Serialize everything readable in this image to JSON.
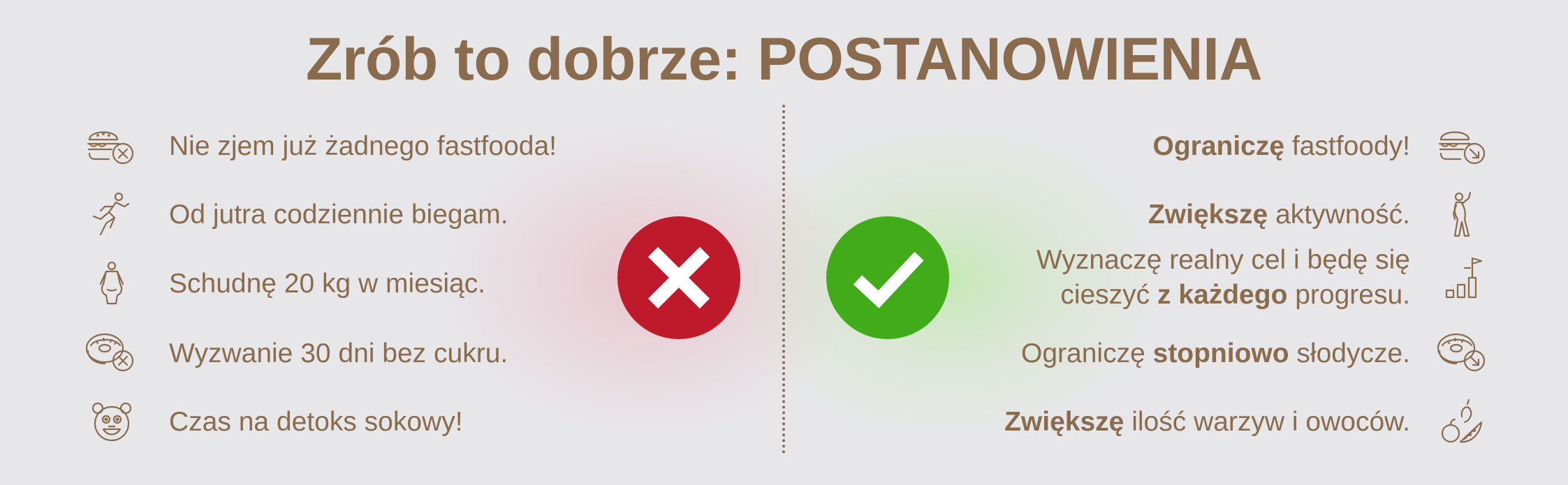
{
  "title": "Zrób to dobrze: POSTANOWIENIA",
  "colors": {
    "brown": "#8b6b4d",
    "red": "#be1a2b",
    "green": "#42ab19",
    "background": "#e7e7e9"
  },
  "bad": [
    {
      "icon": "burger-crossed-icon",
      "text": "Nie zjem już żadnego fastfooda!"
    },
    {
      "icon": "runner-icon",
      "text": "Od jutra codziennie biegam."
    },
    {
      "icon": "person-weight-icon",
      "text": "Schudnę 20 kg w miesiąc."
    },
    {
      "icon": "donut-crossed-icon",
      "text": "Wyzwanie 30 dni bez cukru."
    },
    {
      "icon": "juice-face-icon",
      "text": "Czas na detoks sokowy!"
    }
  ],
  "good": [
    {
      "icon": "burger-arrow-icon",
      "bold": "Ograniczę",
      "rest": " fastfoody!"
    },
    {
      "icon": "stretching-person-icon",
      "bold": "Zwiększę",
      "rest": " aktywność."
    },
    {
      "icon": "progress-steps-icon",
      "line1": "Wyznaczę realny cel i będę się",
      "line2_pre": "cieszyć ",
      "line2_bold": "z każdego",
      "line2_post": " progresu."
    },
    {
      "icon": "donut-arrow-icon",
      "pre": "Ograniczę ",
      "bold": "stopniowo",
      "rest": " słodycze."
    },
    {
      "icon": "fruits-icon",
      "bold": "Zwiększę",
      "rest": " ilość warzyw i owoców."
    }
  ],
  "badges": {
    "wrong": "cross-icon",
    "right": "check-icon"
  }
}
